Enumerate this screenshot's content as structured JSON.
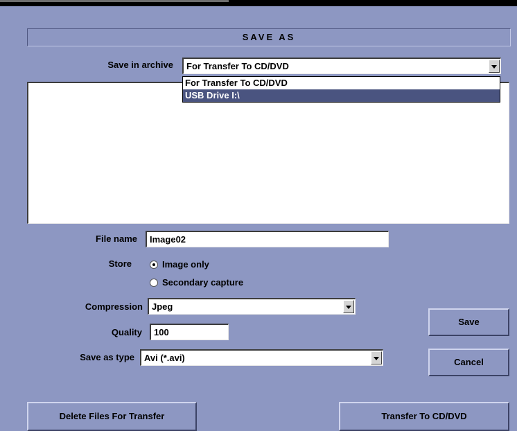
{
  "dialog": {
    "title": "SAVE AS"
  },
  "archive": {
    "label": "Save in archive",
    "selected": "For Transfer To CD/DVD",
    "options": [
      "For Transfer To CD/DVD",
      "USB Drive  I:\\"
    ]
  },
  "file_name": {
    "label": "File name",
    "value": "Image02"
  },
  "store": {
    "label": "Store",
    "options": [
      {
        "label": "Image only",
        "checked": true
      },
      {
        "label": "Secondary capture",
        "checked": false
      }
    ]
  },
  "compression": {
    "label": "Compression",
    "value": "Jpeg"
  },
  "quality": {
    "label": "Quality",
    "value": "100"
  },
  "save_as_type": {
    "label": "Save as type",
    "value": "Avi  (*.avi)"
  },
  "buttons": {
    "save": "Save",
    "cancel": "Cancel",
    "delete": "Delete Files For Transfer",
    "transfer": "Transfer To CD/DVD"
  }
}
